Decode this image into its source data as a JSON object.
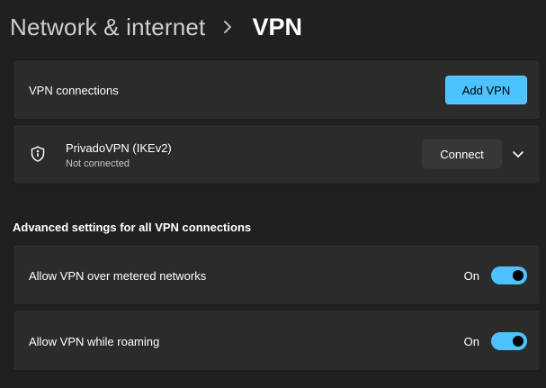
{
  "header": {
    "parent": "Network & internet",
    "separator_icon": "chevron-right-icon",
    "current": "VPN"
  },
  "vpn_connections": {
    "label": "VPN connections",
    "add_button": "Add VPN"
  },
  "vpn_item": {
    "icon": "shield-icon",
    "name": "PrivadoVPN (IKEv2)",
    "status": "Not connected",
    "connect_button": "Connect",
    "expand_icon": "chevron-down-icon"
  },
  "advanced": {
    "heading": "Advanced settings for all VPN connections",
    "settings": [
      {
        "label": "Allow VPN over metered networks",
        "state": "On",
        "enabled": true
      },
      {
        "label": "Allow VPN while roaming",
        "state": "On",
        "enabled": true
      }
    ]
  },
  "colors": {
    "background": "#202020",
    "card": "#2b2b2b",
    "accent": "#4cc2ff"
  }
}
